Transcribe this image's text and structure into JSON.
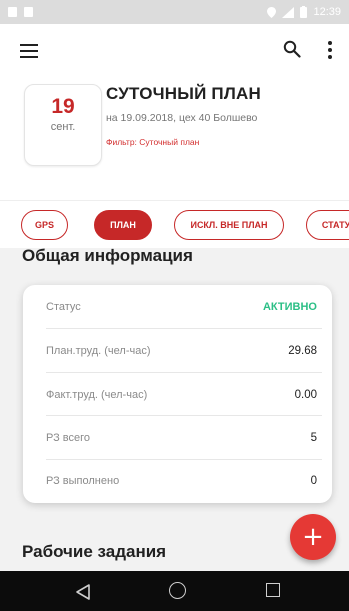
{
  "status_bar": {
    "time": "12:39"
  },
  "toolbar": {
    "menu_icon": "menu-icon",
    "search_icon": "search-icon",
    "more_icon": "more-vert-icon"
  },
  "plan": {
    "day": "19",
    "month": "сент.",
    "title": "СУТОЧНЫЙ ПЛАН",
    "subtitle": "на 19.09.2018, цех 40 Болшево",
    "filter": "Фильтр: Суточный план"
  },
  "chips": [
    {
      "label": "GPS",
      "active": false
    },
    {
      "label": "ПЛАН",
      "active": true
    },
    {
      "label": "ИСКЛ. ВНЕ ПЛАН",
      "active": false
    },
    {
      "label": "СТАТУ",
      "active": false
    }
  ],
  "info": {
    "title": "Общая информация",
    "rows": [
      {
        "label": "Статус",
        "value": "АКТИВНО"
      },
      {
        "label": "План.труд. (чел-час)",
        "value": "29.68"
      },
      {
        "label": "Факт.труд. (чел-час)",
        "value": "0.00"
      },
      {
        "label": "РЗ всего",
        "value": "5"
      },
      {
        "label": "РЗ выполнено",
        "value": "0"
      }
    ]
  },
  "tasks": {
    "title": "Рабочие задания"
  },
  "fab": {
    "label": "+"
  },
  "colors": {
    "accent": "#c62828",
    "status_active": "#2bbf86",
    "fab": "#e53935"
  }
}
